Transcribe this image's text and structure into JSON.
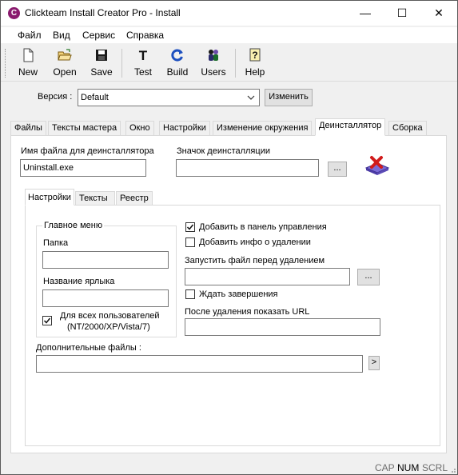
{
  "window": {
    "title": "Clickteam Install Creator Pro - Install",
    "minimize_glyph": "—",
    "maximize_glyph": "☐",
    "close_glyph": "✕"
  },
  "menu": [
    "Файл",
    "Вид",
    "Сервис",
    "Справка"
  ],
  "toolbar": {
    "new": "New",
    "open": "Open",
    "save": "Save",
    "test": "Test",
    "build": "Build",
    "users": "Users",
    "help": "Help"
  },
  "version": {
    "label": "Версия :",
    "value": "Default",
    "change_button": "Изменить"
  },
  "tabs": [
    "Файлы",
    "Тексты мастера",
    "Окно",
    "Настройки",
    "Изменение окружения",
    "Деинсталлятор",
    "Сборка"
  ],
  "active_tab": "Деинсталлятор",
  "uninstaller": {
    "filename_label": "Имя файла для деинсталлятора",
    "filename_value": "Uninstall.exe",
    "icon_label": "Значок деинсталляции",
    "icon_value": "",
    "browse_label": "...",
    "subtabs": [
      "Настройки",
      "Тексты",
      "Реестр"
    ],
    "active_subtab": "Настройки",
    "start_menu": {
      "group_label": "Главное меню",
      "folder_label": "Папка",
      "folder_value": "",
      "shortcut_label": "Название ярлыка",
      "shortcut_value": "",
      "all_users_line1": "Для всех пользователей",
      "all_users_line2": "(NT/2000/XP/Vista/7)",
      "all_users_checked": true
    },
    "add_control_panel": {
      "label": "Добавить в панель управления",
      "checked": true
    },
    "add_uninstall_info": {
      "label": "Добавить инфо о удалении",
      "checked": false
    },
    "run_before_label": "Запустить файл перед удалением",
    "run_before_value": "",
    "wait_completion": {
      "label": "Ждать завершения",
      "checked": false
    },
    "after_url_label": "После удаления показать URL",
    "after_url_value": "",
    "extra_files_label": "Дополнительные файлы :",
    "extra_files_value": "",
    "extra_files_button": ">"
  },
  "status": {
    "cap": "CAP",
    "num": "NUM",
    "scrl": "SCRL"
  },
  "colors": {
    "app_icon": "#8a1a6e",
    "build_icon": "#1c4fbf",
    "uninstall_icon_x": "#d11b1b",
    "uninstall_icon_base": "#7b6bd6"
  }
}
